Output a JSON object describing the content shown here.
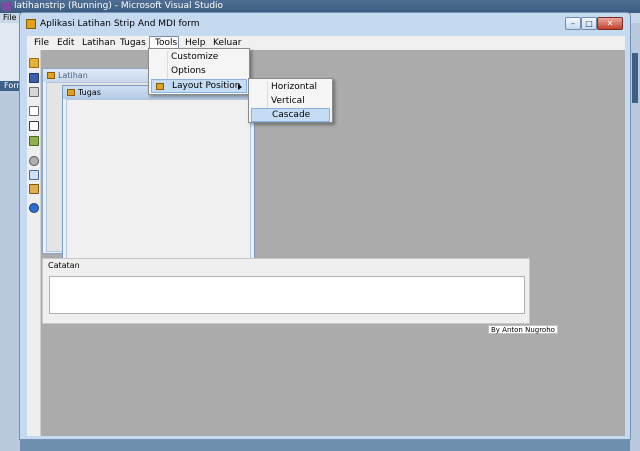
{
  "vs": {
    "title": "latihanstrip (Running) - Microsoft Visual Studio",
    "menu": [
      "File"
    ],
    "side_tab": "Form"
  },
  "app": {
    "title": "Aplikasi Latihan Strip And MDI form",
    "controls": {
      "minimize": "–",
      "maximize": "□",
      "close": "✕"
    }
  },
  "menubar": {
    "items": [
      {
        "label": "File"
      },
      {
        "label": "Edit"
      },
      {
        "label": "Latihan"
      },
      {
        "label": "Tugas"
      },
      {
        "label": "Tools",
        "open": true
      },
      {
        "label": "Help"
      },
      {
        "label": "Keluar"
      }
    ]
  },
  "tools_menu": {
    "items": [
      {
        "label": "Customize"
      },
      {
        "label": "Options"
      },
      {
        "label": "Layout Position",
        "submenu": true,
        "icon": "window-layout-icon",
        "highlighted": true
      }
    ]
  },
  "layout_submenu": {
    "items": [
      {
        "label": "Horizontal"
      },
      {
        "label": "Vertical"
      },
      {
        "label": "Cascade",
        "highlighted": true
      }
    ]
  },
  "toolstrip_icons": [
    "open-folder-icon",
    "save-icon",
    "print-icon",
    "preview-icon",
    "list-icon",
    "image-icon",
    "cut-icon",
    "copy-icon",
    "paste-icon",
    "help-icon"
  ],
  "mdi": {
    "latihan_title": "Latihan",
    "tugas_title": "Tugas"
  },
  "catatan": {
    "label": "Catatan",
    "value": ""
  },
  "author": "By Anton Nugroho"
}
